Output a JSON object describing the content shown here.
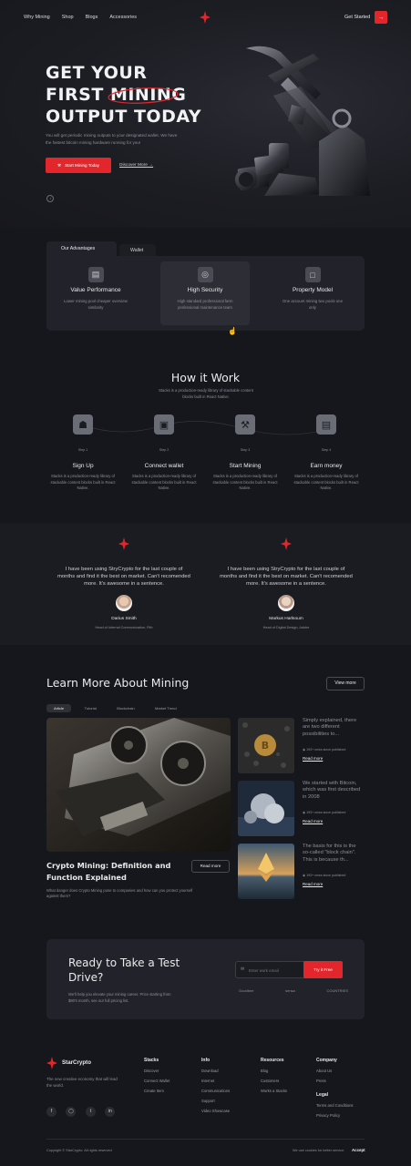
{
  "nav": {
    "links": [
      "Why Mining",
      "Shop",
      "Blogs",
      "Accessories"
    ],
    "cta_label": "Get Started"
  },
  "hero": {
    "line1": "GET YOUR",
    "line2a": "FIRST",
    "line2b": "MINING",
    "line3": "OUTPUT TODAY",
    "subtitle": "You will get periodic mining outputs to your designated wallet. We have the fastest bitcoin mining hardware running for you!",
    "primary_cta": "Start Mining Today",
    "secondary_cta": "Discover More"
  },
  "advantages": {
    "tabs": [
      "Our Advantages",
      "Wallet"
    ],
    "cards": [
      {
        "title": "Value Performance",
        "sub": "Lower mining pool cheaper overview similarity",
        "icon": "wallet-icon"
      },
      {
        "title": "High Security",
        "sub": "High standard professional farm professional maintenance team",
        "icon": "shield-icon"
      },
      {
        "title": "Property Model",
        "sub": "One account mining two pools one only",
        "icon": "presentation-icon"
      }
    ]
  },
  "how": {
    "title": "How it Work",
    "subtitle": "Stacks is a production-ready library of stackable content blocks built in React Native.",
    "steps": [
      {
        "no": "Step 1",
        "title": "Sign Up",
        "sub": "Stacks is a production-ready library of stackable content blocks built in React Native."
      },
      {
        "no": "Step 2",
        "title": "Connect wallet",
        "sub": "Stacks is a production-ready library of stackable content blocks built in React Native."
      },
      {
        "no": "Step 3",
        "title": "Start Mining",
        "sub": "Stacks is a production-ready library of stackable content blocks built in React Native."
      },
      {
        "no": "Step 4",
        "title": "Earn money",
        "sub": "Stacks is a production-ready library of stackable content blocks built in React Native."
      }
    ]
  },
  "testimonials": [
    {
      "quote": "I have been using StryCrypto for the last couple of months and find it the best on market. Can't recomended more. It's awesome in a sentence.",
      "name": "Darius Smith",
      "role": "Head of Internal Communication, Fitb"
    },
    {
      "quote": "I have been using StryCrypto for the last couple of months and find it the best on market. Can't recomended more. It's awesome in a sentence.",
      "name": "Markus Harlsoum",
      "role": "Head of Digital Design, Adobe"
    }
  ],
  "learn": {
    "title": "Learn More About Mining",
    "view_more": "View more",
    "tabs": [
      "Article",
      "Tutorial",
      "Blockchain",
      "Market Trend"
    ],
    "main_title": "Crypto Mining: Definition and Function Explained",
    "main_read": "Read more",
    "main_sub": "What danger does Crypto Mining pose to companies and how can you protect yourself against them?",
    "side": [
      {
        "text": "Simply explained, there are two different possibilities to...",
        "meta": "193+   news since published",
        "read": "Read more"
      },
      {
        "text": "We started with Bitcoin, which was first described in 2008",
        "meta": "193+   news since published",
        "read": "Read more"
      },
      {
        "text": "The basis for this is the so-called \"block chain\". This is because th...",
        "meta": "193+   news since published",
        "read": "Read more"
      }
    ]
  },
  "cta": {
    "title": "Ready to Take a Test Drive?",
    "sub": "We'll help you elevate your mining career. Price starting from $80's month, see our full pricing list.",
    "placeholder": "Enter work email",
    "button": "Try it Free",
    "brands": [
      "Goodbee",
      "sensa",
      "COUNTRIES"
    ]
  },
  "footer": {
    "brand": "StarCrypto",
    "tagline": "The new creative economy that will lead the world.",
    "cols": [
      {
        "h": "Stacks",
        "items": [
          "Discover",
          "Connect Wallet",
          "Create Item"
        ]
      },
      {
        "h": "Info",
        "items": [
          "Download",
          "Internet",
          "Communications",
          "Support",
          "Video Showcase"
        ]
      },
      {
        "h": "Resources",
        "items": [
          "Blog",
          "Customers",
          "Works a Stacks"
        ]
      },
      {
        "h": "Company",
        "items": [
          "About Us",
          "Press"
        ]
      }
    ],
    "legal_h": "Legal",
    "legal": [
      "Terms and Conditions",
      "Privacy Policy"
    ],
    "copyright": "Copyright © StarCrypto. All rights reserved",
    "cookie": "We use cookies for better service.",
    "accept": "Accept"
  },
  "colors": {
    "accent": "#e3262b",
    "bg": "#16171c",
    "panel": "#22232a"
  }
}
